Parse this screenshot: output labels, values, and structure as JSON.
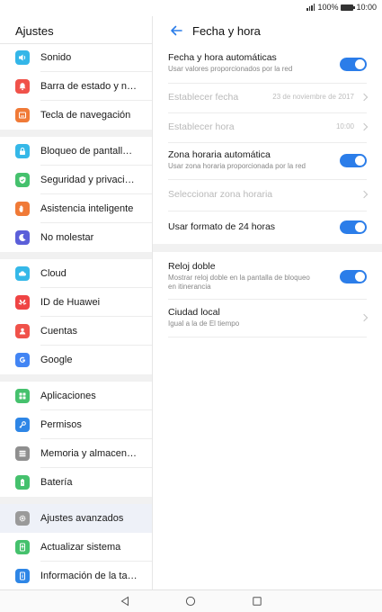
{
  "status_bar": {
    "battery": "100%",
    "time": "10:00"
  },
  "left_panel": {
    "title": "Ajustes",
    "items": [
      {
        "label": "Sonido",
        "icon": "sound-icon",
        "color": "#34b6e8"
      },
      {
        "label": "Barra de estado y notificaciones",
        "icon": "notification-bell-icon",
        "color": "#f0524a"
      },
      {
        "label": "Tecla de navegación",
        "icon": "navigation-key-icon",
        "color": "#f07a37"
      },
      {
        "label": "Bloqueo de pantalla y contraseñas",
        "icon": "lock-icon",
        "color": "#35b8e8"
      },
      {
        "label": "Seguridad y privacidad",
        "icon": "shield-icon",
        "color": "#45c16d"
      },
      {
        "label": "Asistencia inteligente",
        "icon": "hand-icon",
        "color": "#f07a37"
      },
      {
        "label": "No molestar",
        "icon": "moon-icon",
        "color": "#5b5fd9"
      },
      {
        "label": "Cloud",
        "icon": "cloud-icon",
        "color": "#35b8e8"
      },
      {
        "label": "ID de Huawei",
        "icon": "huawei-icon",
        "color": "#ef4444"
      },
      {
        "label": "Cuentas",
        "icon": "account-icon",
        "color": "#f0524a"
      },
      {
        "label": "Google",
        "icon": "google-icon",
        "color": "#4285f4"
      },
      {
        "label": "Aplicaciones",
        "icon": "apps-icon",
        "color": "#45c16d"
      },
      {
        "label": "Permisos",
        "icon": "key-icon",
        "color": "#2e86e6"
      },
      {
        "label": "Memoria y almacenamiento",
        "icon": "storage-icon",
        "color": "#8f8f8f"
      },
      {
        "label": "Batería",
        "icon": "battery-icon",
        "color": "#45c16d"
      },
      {
        "label": "Ajustes avanzados",
        "icon": "gear-icon",
        "color": "#9a9a9a"
      },
      {
        "label": "Actualizar sistema",
        "icon": "update-icon",
        "color": "#45c16d"
      },
      {
        "label": "Información de la tablet",
        "icon": "info-icon",
        "color": "#2e86e6"
      }
    ]
  },
  "right_panel": {
    "title": "Fecha y hora",
    "auto_datetime": {
      "title": "Fecha y hora automáticas",
      "subtitle": "Usar valores proporcionados por la red"
    },
    "set_date": {
      "title": "Establecer fecha",
      "value": "23 de noviembre de 2017"
    },
    "set_time": {
      "title": "Establecer hora",
      "value": "10:00"
    },
    "auto_timezone": {
      "title": "Zona horaria automática",
      "subtitle": "Usar zona horaria proporcionada por la red"
    },
    "select_timezone": {
      "title": "Seleccionar zona horaria"
    },
    "format_24h": {
      "title": "Usar formato de 24 horas"
    },
    "dual_clock": {
      "title": "Reloj doble",
      "subtitle": "Mostrar reloj doble en la pantalla de bloqueo en itinerancia"
    },
    "local_city": {
      "title": "Ciudad local",
      "subtitle": "Igual a la de El tiempo"
    }
  },
  "colors": {
    "accent": "#2b7de9"
  }
}
